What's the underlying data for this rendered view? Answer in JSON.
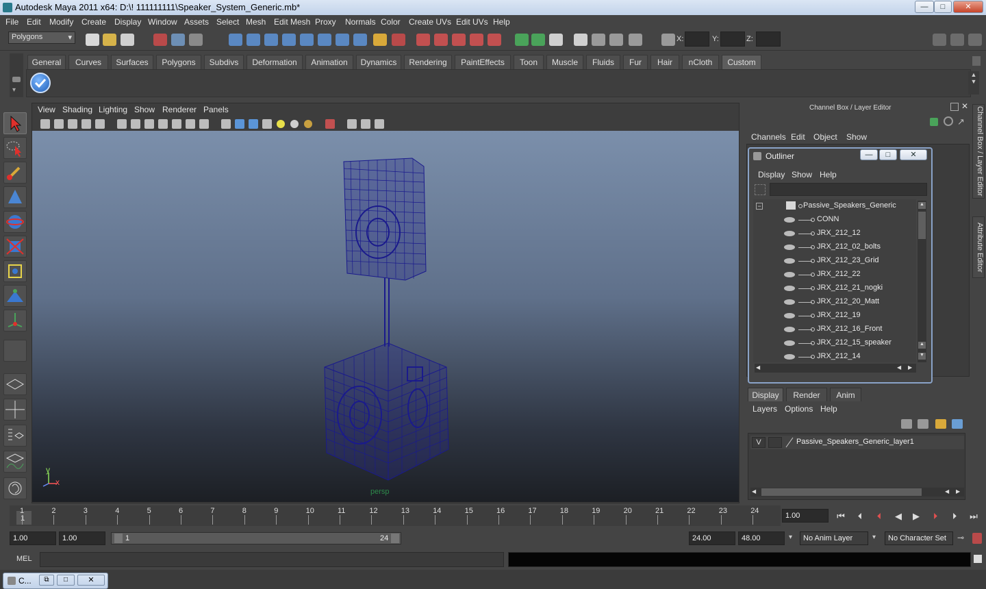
{
  "window": {
    "title": "Autodesk Maya 2011 x64: D:\\! 111111111\\Speaker_System_Generic.mb*",
    "minimize": "—",
    "maximize": "□",
    "close": "✕"
  },
  "menubar": [
    "File",
    "Edit",
    "Modify",
    "Create",
    "Display",
    "Window",
    "Assets",
    "Select",
    "Mesh",
    "Edit Mesh",
    "Proxy",
    "Normals",
    "Color",
    "Create UVs",
    "Edit UVs",
    "Help"
  ],
  "statusline": {
    "mode": "Polygons",
    "x_label": "X:",
    "y_label": "Y:",
    "z_label": "Z:"
  },
  "shelf": {
    "tabs": [
      "General",
      "Curves",
      "Surfaces",
      "Polygons",
      "Subdivs",
      "Deformation",
      "Animation",
      "Dynamics",
      "Rendering",
      "PaintEffects",
      "Toon",
      "Muscle",
      "Fluids",
      "Fur",
      "Hair",
      "nCloth",
      "Custom"
    ],
    "active_tab": "Custom"
  },
  "viewport": {
    "menu": [
      "View",
      "Shading",
      "Lighting",
      "Show",
      "Renderer",
      "Panels"
    ],
    "camera_label": "persp",
    "axis_y": "y",
    "axis_x": "x"
  },
  "channel_box": {
    "header": "Channel Box / Layer Editor",
    "menu": [
      "Channels",
      "Edit",
      "Object",
      "Show"
    ]
  },
  "outliner": {
    "title": "Outliner",
    "menu": [
      "Display",
      "Show",
      "Help"
    ],
    "root": "Passive_Speakers_Generic",
    "items": [
      "CONN",
      "JRX_212_12",
      "JRX_212_02_bolts",
      "JRX_212_23_Grid",
      "JRX_212_22",
      "JRX_212_21_nogki",
      "JRX_212_20_Matt",
      "JRX_212_19",
      "JRX_212_16_Front",
      "JRX_212_15_speaker",
      "JRX_212_14"
    ]
  },
  "layer_editor": {
    "tabs": [
      "Display",
      "Render",
      "Anim"
    ],
    "active_tab": "Display",
    "menu": [
      "Layers",
      "Options",
      "Help"
    ],
    "layer_visibility": "V",
    "layer_name": "Passive_Speakers_Generic_layer1"
  },
  "timeline": {
    "ticks": [
      "1",
      "2",
      "3",
      "4",
      "5",
      "6",
      "7",
      "8",
      "9",
      "10",
      "11",
      "12",
      "13",
      "14",
      "15",
      "16",
      "17",
      "18",
      "19",
      "20",
      "21",
      "22",
      "23",
      "24"
    ],
    "current_frame_marker": "1",
    "current_time": "1.00"
  },
  "range": {
    "start_time": "1.00",
    "playback_start": "1.00",
    "slider_start": "1",
    "slider_end": "24",
    "playback_end": "24.00",
    "end_time": "48.00",
    "anim_layer": "No Anim Layer",
    "character_set": "No Character Set"
  },
  "command_line": {
    "label": "MEL"
  },
  "right_dock": {
    "tab1": "Channel Box / Layer Editor",
    "tab2": "Attribute Editor"
  },
  "taskbar": {
    "label": "C..."
  },
  "colors": {
    "wireframe": "#1a1a8c",
    "bg_panel": "#444444",
    "title_gradient_top": "#dbe6f4"
  }
}
